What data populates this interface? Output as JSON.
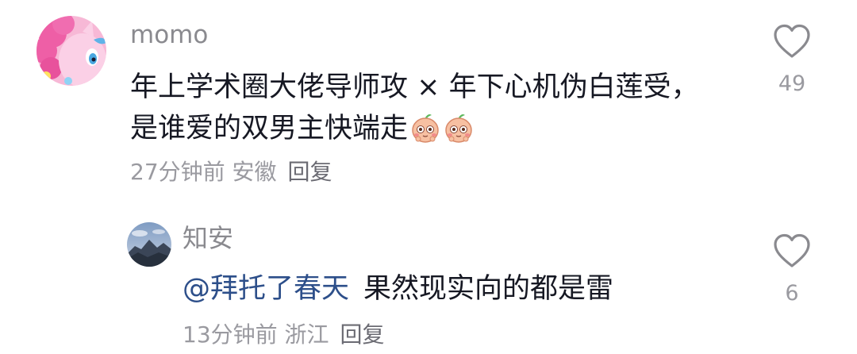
{
  "comments": [
    {
      "username": "momo",
      "text": "年上学术圈大佬导师攻 × 年下心机伪白莲受，是谁爱的双男主快端走",
      "emojis": [
        "peach-face-emoji",
        "peach-face-emoji"
      ],
      "meta": "27分钟前 安徽",
      "reply_label": "回复",
      "likes": "49",
      "avatar": "pink-pony-avatar"
    },
    {
      "username": "知安",
      "mention": "@拜托了春天",
      "text": "果然现实向的都是雷",
      "meta": "13分钟前 浙江",
      "reply_label": "回复",
      "likes": "6",
      "avatar": "mountain-sky-avatar"
    }
  ],
  "colors": {
    "text": "#161823",
    "secondary": "#8a8a8f",
    "mention": "#2d4f8a",
    "background": "#ffffff"
  }
}
